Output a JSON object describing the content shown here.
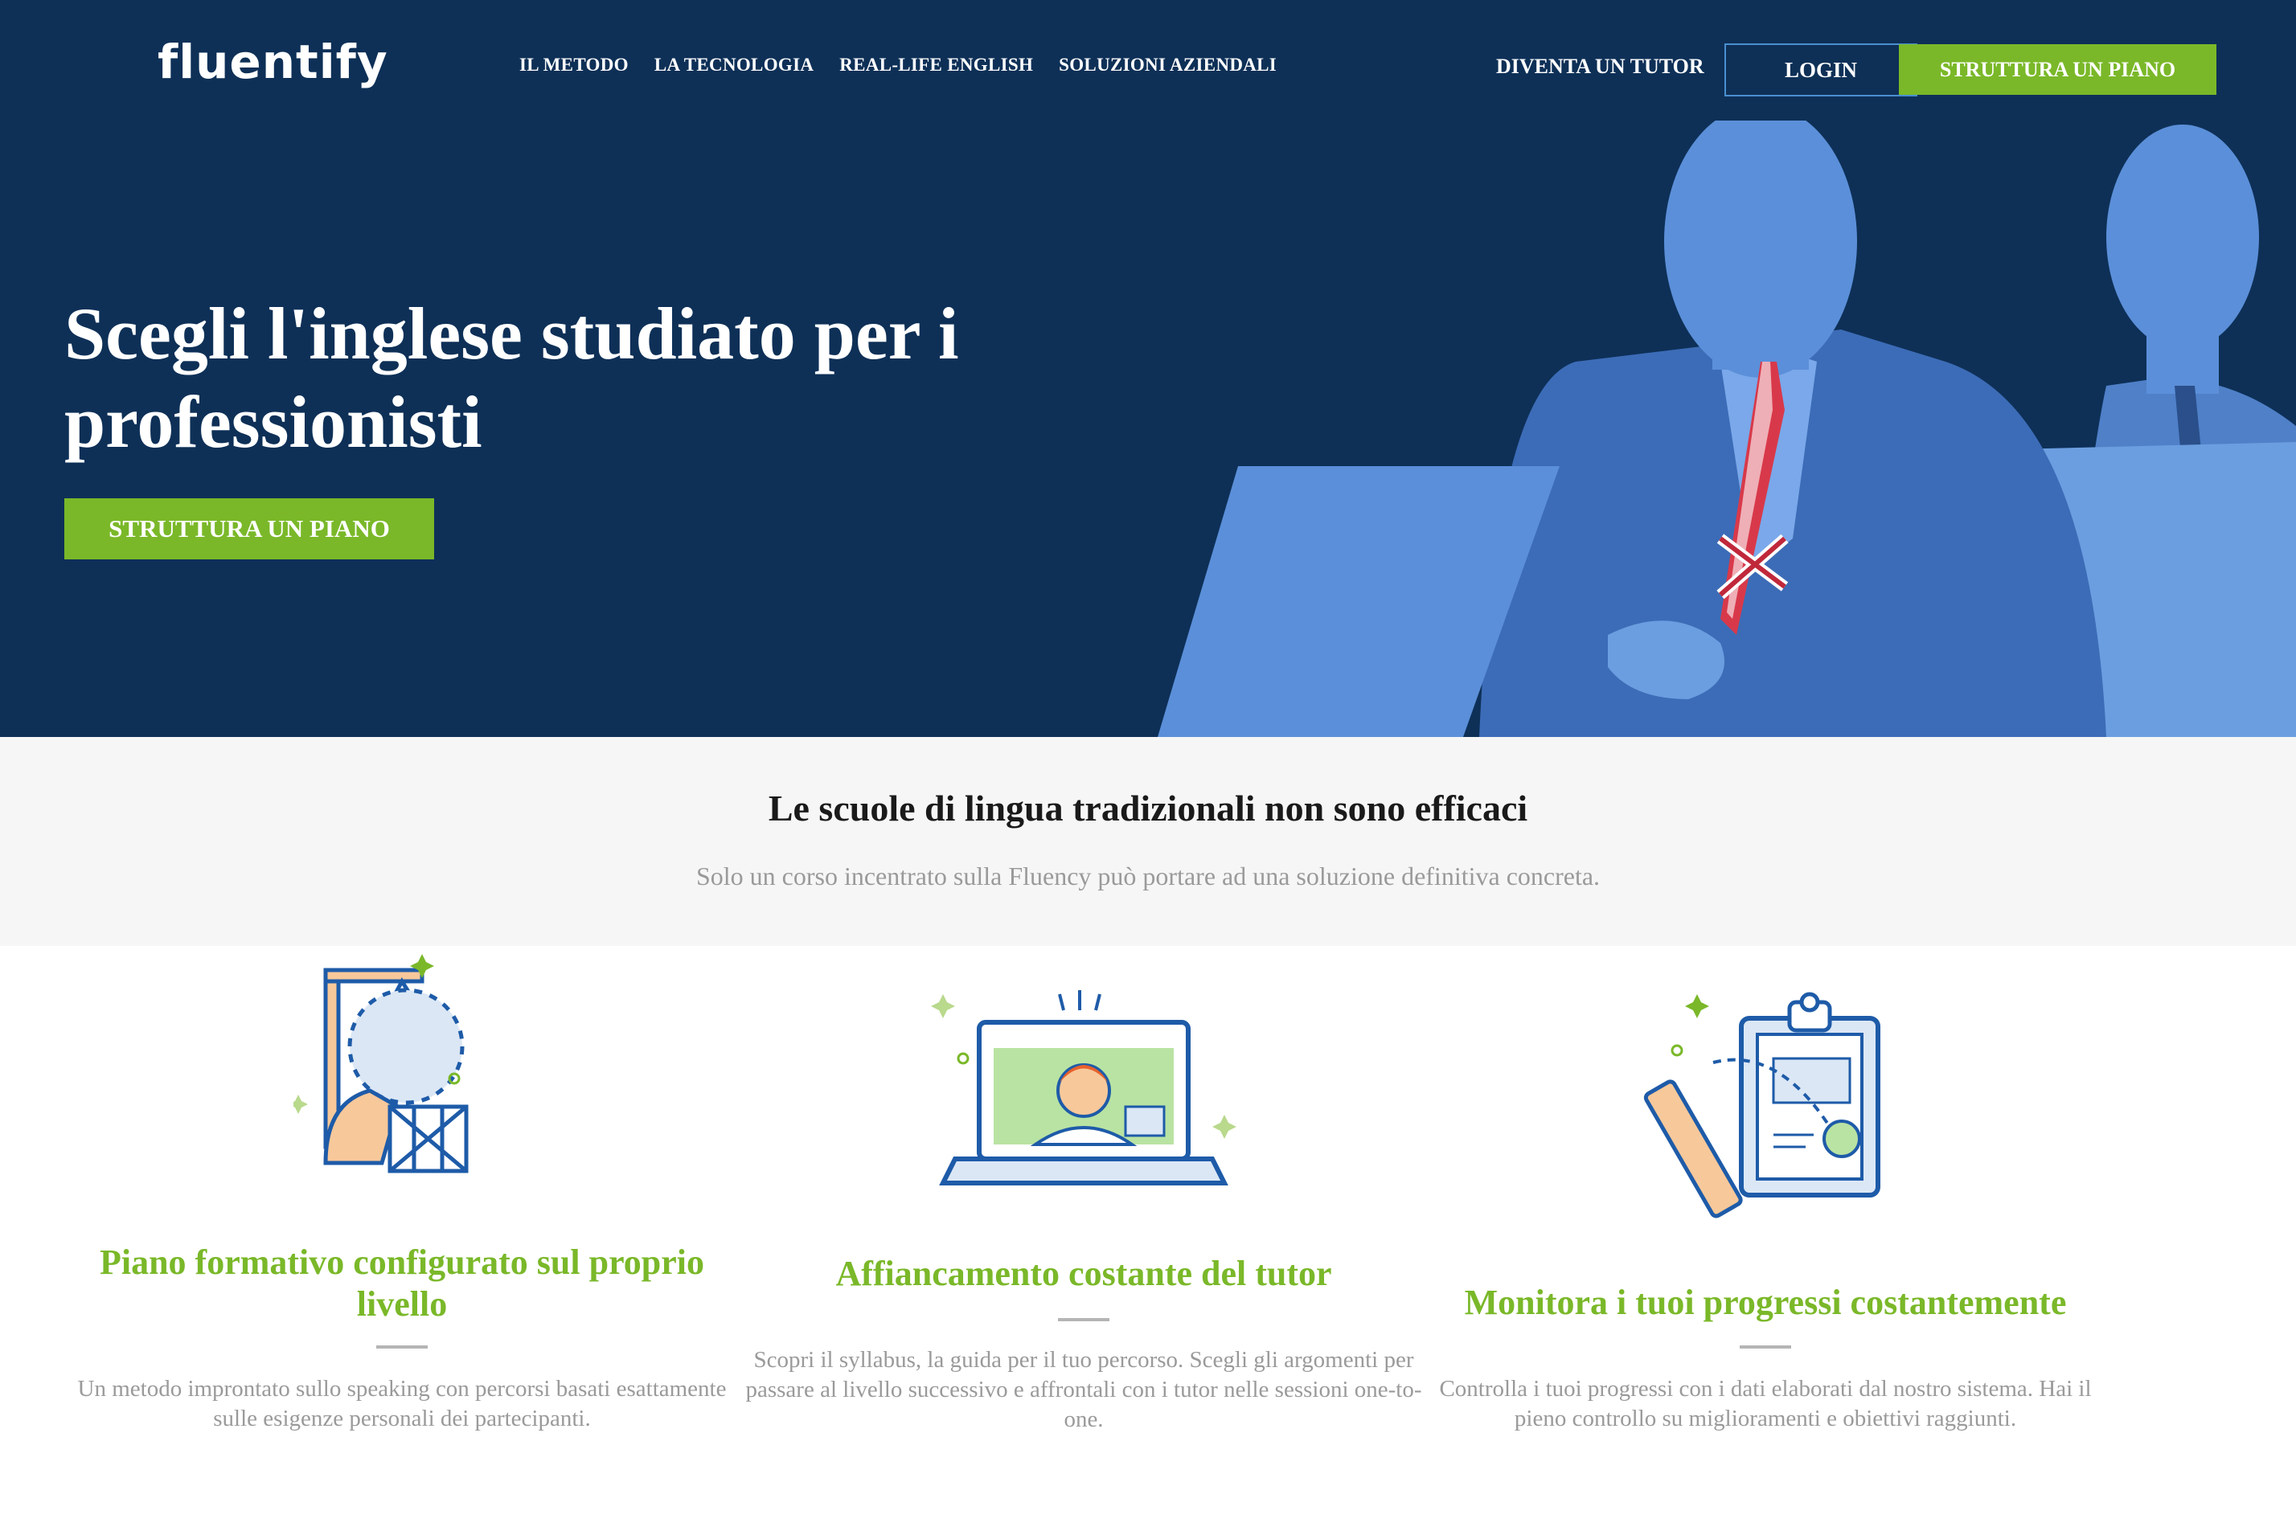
{
  "brand": {
    "logo_text": "fluentify",
    "colors": {
      "navy": "#0e3057",
      "green": "#7ab829",
      "figure_blue": "#5b8fd9"
    }
  },
  "nav": {
    "items": [
      {
        "label": "IL METODO"
      },
      {
        "label": "LA TECNOLOGIA"
      },
      {
        "label": "REAL-LIFE ENGLISH"
      },
      {
        "label": "SOLUZIONI AZIENDALI"
      }
    ],
    "tutor_label": "DIVENTA UN TUTOR",
    "login_label": "LOGIN",
    "plan_label": "STRUTTURA UN PIANO"
  },
  "hero": {
    "title": "Scegli l'inglese studiato per i professionisti",
    "cta_label": "STRUTTURA UN PIANO"
  },
  "intro": {
    "title": "Le scuole di lingua tradizionali non sono efficaci",
    "subtitle": "Solo un corso incentrato sulla Fluency può portare ad una soluzione definitiva concreta."
  },
  "features": [
    {
      "icon": "construction-plan-icon",
      "title": "Piano formativo configurato sul proprio livello",
      "description": "Un metodo improntato sullo speaking con percorsi basati esattamente sulle esigenze personali dei partecipanti."
    },
    {
      "icon": "video-call-laptop-icon",
      "title": "Affiancamento costante del tutor",
      "description": "Scopri il syllabus, la guida per il tuo percorso. Scegli gli argomenti per passare al livello successivo e affrontali con i tutor nelle sessioni one-to-one."
    },
    {
      "icon": "clipboard-progress-icon",
      "title": "Monitora i tuoi progressi costantemente",
      "description": "Controlla i tuoi progressi con i dati elaborati dal nostro sistema. Hai il pieno controllo su miglioramenti e obiettivi raggiunti."
    }
  ]
}
